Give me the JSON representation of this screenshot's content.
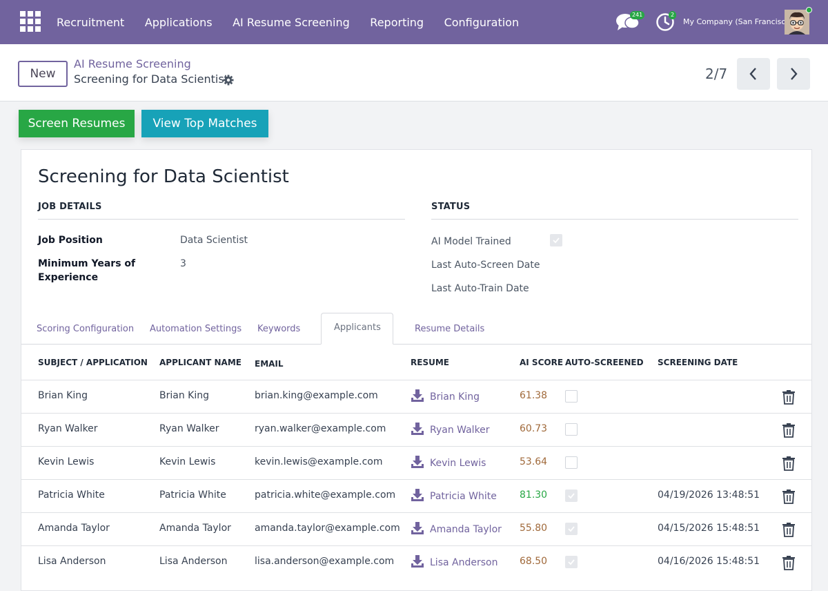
{
  "nav": {
    "menu": [
      "Recruitment",
      "Applications",
      "AI Resume Screening",
      "Reporting",
      "Configuration"
    ],
    "messages_badge": "241",
    "activities_badge": "2",
    "company": "My Company (San Francisco)"
  },
  "control": {
    "new_label": "New",
    "breadcrumb_parent": "AI Resume Screening",
    "breadcrumb_current": "Screening for Data Scientist",
    "pager": "2/7"
  },
  "actions": {
    "screen": "Screen Resumes",
    "top": "View Top Matches"
  },
  "form": {
    "title": "Screening for Data Scientist",
    "job_header": "JOB DETAILS",
    "status_header": "STATUS",
    "job_position_label": "Job Position",
    "job_position": "Data Scientist",
    "min_years_label": "Minimum Years of Experience",
    "min_years": "3",
    "ai_trained_label": "AI Model Trained",
    "ai_trained": true,
    "last_screen_label": "Last Auto-Screen Date",
    "last_train_label": "Last Auto-Train Date"
  },
  "tabs": [
    "Scoring Configuration",
    "Automation Settings",
    "Keywords",
    "Applicants",
    "Resume Details"
  ],
  "active_tab": "Applicants",
  "table": {
    "columns": [
      "SUBJECT / APPLICATION",
      "APPLICANT NAME",
      "EMAIL",
      "RESUME",
      "AI SCORE",
      "AUTO-SCREENED",
      "SCREENING DATE"
    ],
    "rows": [
      {
        "subject": "Brian King",
        "name": "Brian King",
        "email": "brian.king@example.com",
        "resume": "Brian King",
        "score": "61.38",
        "auto": false,
        "date": ""
      },
      {
        "subject": "Ryan Walker",
        "name": "Ryan Walker",
        "email": "ryan.walker@example.com",
        "resume": "Ryan Walker",
        "score": "60.73",
        "auto": false,
        "date": ""
      },
      {
        "subject": "Kevin Lewis",
        "name": "Kevin Lewis",
        "email": "kevin.lewis@example.com",
        "resume": "Kevin Lewis",
        "score": "53.64",
        "auto": false,
        "date": ""
      },
      {
        "subject": "Patricia White",
        "name": "Patricia White",
        "email": "patricia.white@example.com",
        "resume": "Patricia White",
        "score": "81.30",
        "auto": true,
        "date": "04/19/2026 13:48:51"
      },
      {
        "subject": "Amanda Taylor",
        "name": "Amanda Taylor",
        "email": "amanda.taylor@example.com",
        "resume": "Amanda Taylor",
        "score": "55.80",
        "auto": true,
        "date": "04/15/2026 15:48:51"
      },
      {
        "subject": "Lisa Anderson",
        "name": "Lisa Anderson",
        "email": "lisa.anderson@example.com",
        "resume": "Lisa Anderson",
        "score": "68.50",
        "auto": true,
        "date": "04/16/2026 15:48:51"
      }
    ]
  },
  "colors": {
    "brand": "#71639e",
    "success": "#28a745",
    "info": "#17a2b8",
    "score_high": "#28a745",
    "score_normal": "#a0693a"
  }
}
